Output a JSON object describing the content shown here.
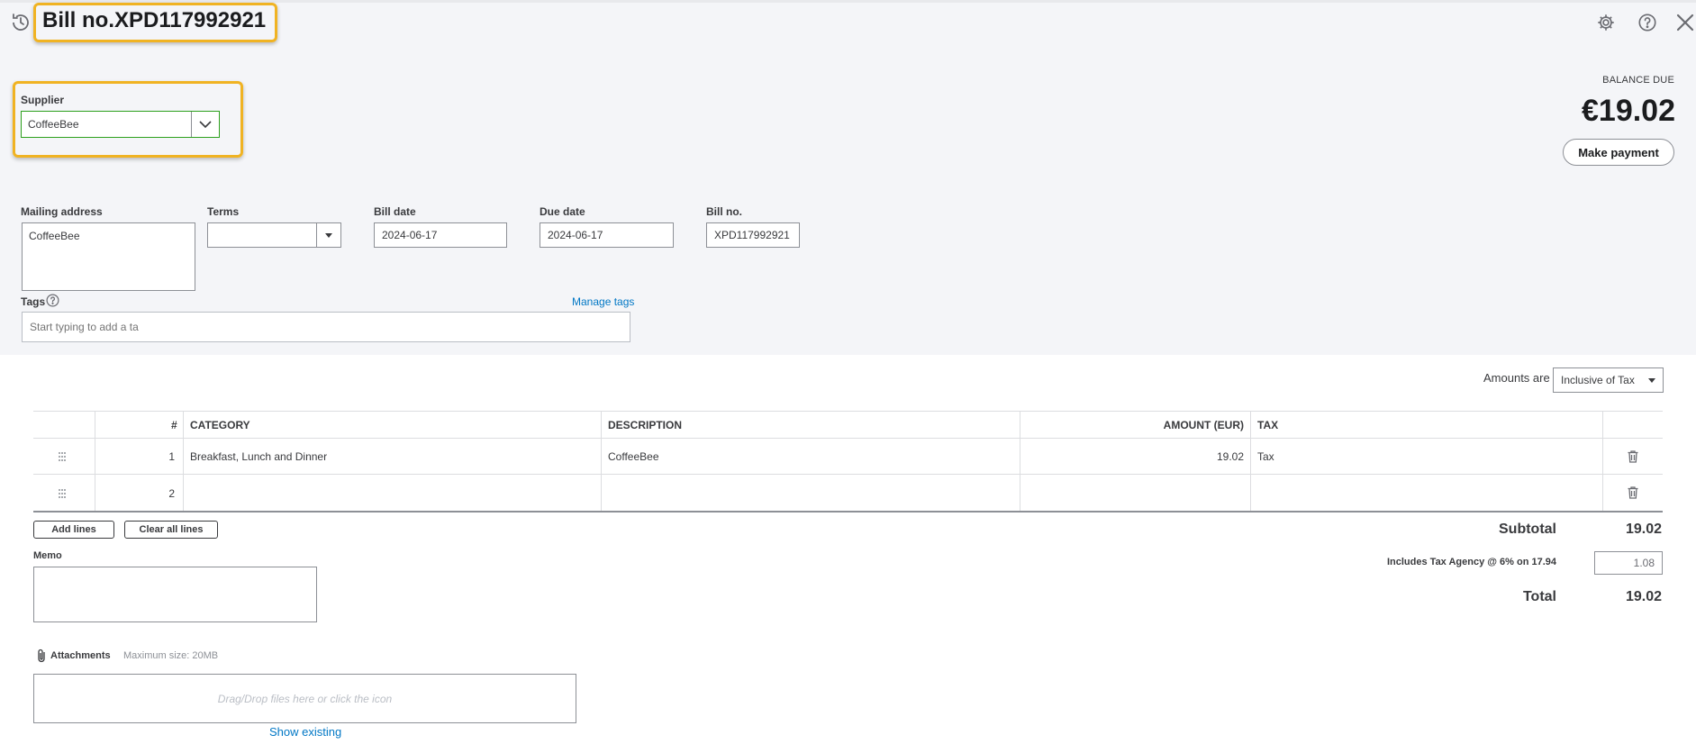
{
  "header": {
    "title": "Bill no.XPD117992921"
  },
  "supplier": {
    "label": "Supplier",
    "value": "CoffeeBee"
  },
  "balance": {
    "label": "BALANCE DUE",
    "amount": "€19.02",
    "pay_button": "Make payment"
  },
  "fields": {
    "mailing_label": "Mailing address",
    "mailing_value": "CoffeeBee",
    "terms_label": "Terms",
    "terms_value": "",
    "bill_date_label": "Bill date",
    "bill_date_value": "2024-06-17",
    "due_date_label": "Due date",
    "due_date_value": "2024-06-17",
    "bill_no_label": "Bill no.",
    "bill_no_value": "XPD117992921"
  },
  "tags": {
    "label": "Tags",
    "manage": "Manage tags",
    "placeholder": "Start typing to add a ta"
  },
  "amounts_are": {
    "label": "Amounts are",
    "value": "Inclusive of Tax"
  },
  "table": {
    "headers": {
      "num": "#",
      "category": "CATEGORY",
      "description": "DESCRIPTION",
      "amount": "AMOUNT (EUR)",
      "tax": "TAX"
    },
    "rows": [
      {
        "num": "1",
        "category": "Breakfast, Lunch and Dinner",
        "description": "CoffeeBee",
        "amount": "19.02",
        "tax": "Tax"
      },
      {
        "num": "2",
        "category": "",
        "description": "",
        "amount": "",
        "tax": ""
      }
    ]
  },
  "buttons": {
    "add_lines": "Add lines",
    "clear_lines": "Clear all lines"
  },
  "totals": {
    "subtotal_label": "Subtotal",
    "subtotal_value": "19.02",
    "tax_label": "Includes Tax Agency @ 6% on 17.94",
    "tax_value": "1.08",
    "total_label": "Total",
    "total_value": "19.02"
  },
  "memo": {
    "label": "Memo"
  },
  "attachments": {
    "label": "Attachments",
    "max_size": "Maximum size: 20MB",
    "drop_text": "Drag/Drop files here or click the icon",
    "show_existing": "Show existing"
  },
  "colors": {
    "highlight": "#f0b323",
    "link": "#0077c5",
    "supplier_border": "#2ca01c",
    "top_background": "#f4f5f8"
  },
  "icons": {
    "history": "history-icon",
    "settings": "gear-icon",
    "help": "help-icon",
    "close": "close-icon",
    "drag": "drag-handle-icon",
    "delete": "trash-icon",
    "attach": "paperclip-icon"
  }
}
